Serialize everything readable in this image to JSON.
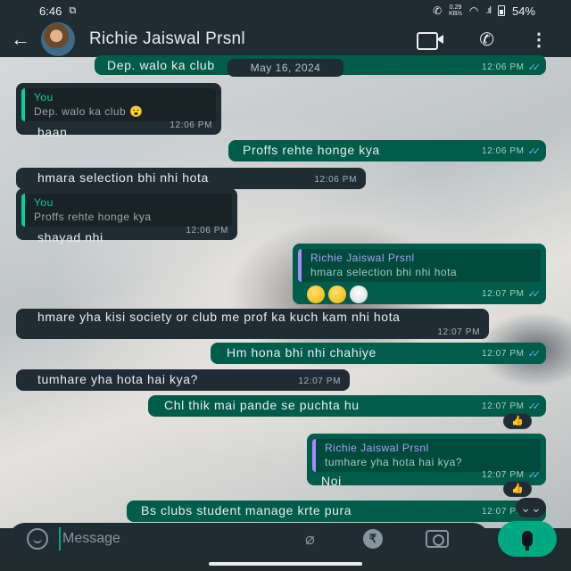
{
  "status_bar": {
    "time": "6:46",
    "net_speed_value": "0.29",
    "net_speed_unit": "KB/s",
    "battery": "54%"
  },
  "header": {
    "title": "Richie Jaiswal Prsnl",
    "icons": [
      "back-arrow-icon",
      "video-call-icon",
      "voice-call-icon",
      "more-options-icon"
    ]
  },
  "date_chip": "May 16, 2024",
  "messages": [
    {
      "dir": "out",
      "text": "Dep. walo ka club",
      "time": "12:06 PM",
      "partial": true
    },
    {
      "dir": "in",
      "quote_author": "You",
      "quote_text": "Dep. walo ka club 😮",
      "text": "haan",
      "time": "12:06 PM"
    },
    {
      "dir": "out",
      "text": "Proffs rehte honge kya",
      "time": "12:06 PM"
    },
    {
      "dir": "in",
      "text": "hmara selection bhi nhi hota",
      "time": "12:06 PM"
    },
    {
      "dir": "in",
      "quote_author": "You",
      "quote_text": "Proffs rehte honge kya",
      "text": "shayad nhi",
      "time": "12:06 PM"
    },
    {
      "dir": "out",
      "quote_author": "Richie Jaiswal Prsnl",
      "quote_text": "hmara selection bhi nhi hota",
      "text": "dizzy dizzy skull",
      "emojis": [
        "dizzy-face",
        "dizzy-face",
        "skull"
      ],
      "time": "12:07 PM"
    },
    {
      "dir": "in",
      "text": "hmare yha kisi society or club me prof ka kuch kam nhi hota",
      "time": "12:07 PM"
    },
    {
      "dir": "out",
      "text": "Hm hona bhi nhi chahiye",
      "time": "12:07 PM"
    },
    {
      "dir": "in",
      "text": "tumhare yha hota hai kya?",
      "time": "12:07 PM"
    },
    {
      "dir": "out",
      "text": "Chl thik mai pande se puchta hu",
      "time": "12:07 PM",
      "reaction": "👍"
    },
    {
      "dir": "out",
      "quote_author": "Richie Jaiswal Prsnl",
      "quote_text": "tumhare yha hota hai kya?",
      "text": "Noi",
      "time": "12:07 PM",
      "reaction": "👍"
    },
    {
      "dir": "out",
      "text": "Bs clubs student manage krte pura",
      "time": "12:07 PM",
      "partial": true
    }
  ],
  "composer": {
    "placeholder": "Message",
    "icons": [
      "emoji-icon",
      "attach-icon",
      "payment-icon",
      "camera-icon",
      "mic-icon"
    ]
  },
  "colors": {
    "incoming_bubble": "#1f2c33",
    "outgoing_bubble": "#005c4b",
    "accent": "#00a884",
    "read_ticks": "#53bdeb"
  }
}
